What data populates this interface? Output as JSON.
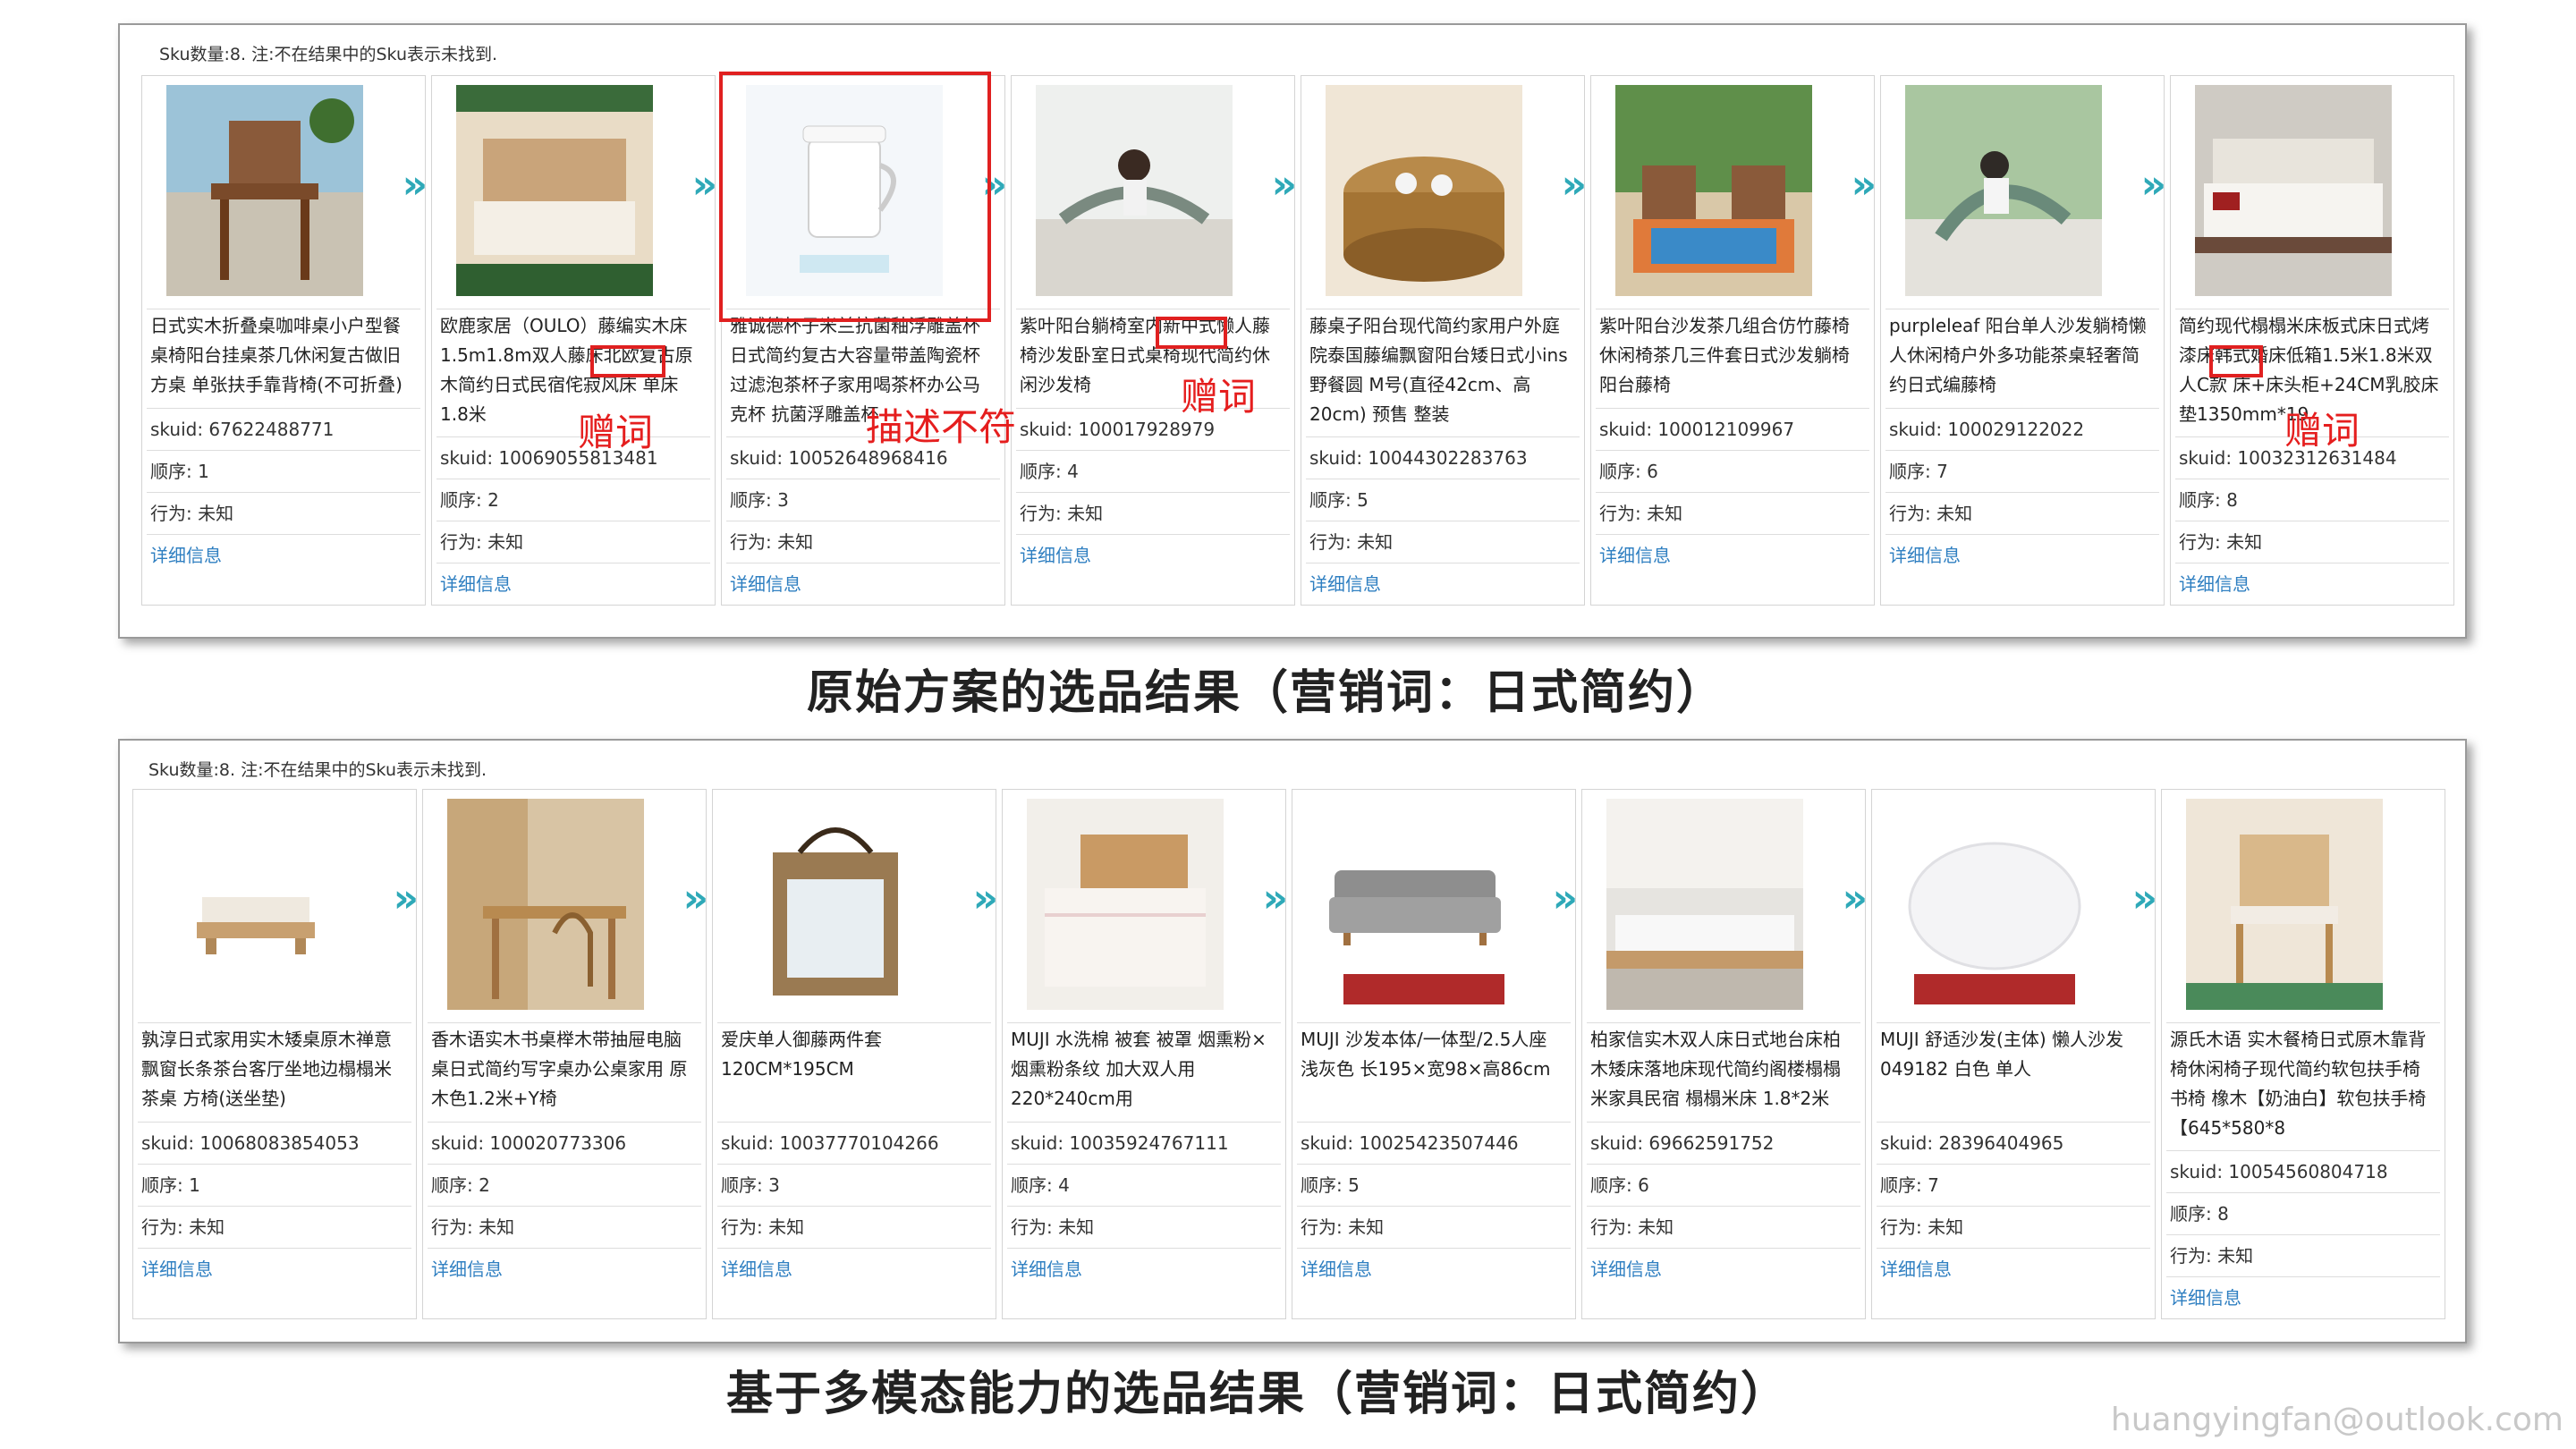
{
  "panel1": {
    "count_text": "Sku数量:8. 注:不在结果中的Sku表示未找到.",
    "caption": "原始方案的选品结果（营销词：日式简约）",
    "cards": [
      {
        "title": "日式实木折叠桌咖啡桌小户型餐桌椅阳台挂桌茶几休闲复古做旧方桌 单张扶手靠背椅(不可折叠)",
        "skuid": "skuid: 67622488771",
        "order": "顺序: 1",
        "behavior": "行为: 未知",
        "detail": "详细信息"
      },
      {
        "title": "欧鹿家居（OULO）藤编实木床1.5m1.8m双人藤床北欧复古原木简约日式民宿侘寂风床 单床 1.8米",
        "skuid": "skuid: 10069055813481",
        "order": "顺序: 2",
        "behavior": "行为: 未知",
        "detail": "详细信息"
      },
      {
        "title": "雅诚德杯子米兰抗菌釉浮雕盖杯日式简约复古大容量带盖陶瓷杯过滤泡茶杯子家用喝茶杯办公马克杯 抗菌浮雕盖杯",
        "skuid": "skuid: 10052648968416",
        "order": "顺序: 3",
        "behavior": "行为: 未知",
        "detail": "详细信息"
      },
      {
        "title": "紫叶阳台躺椅室内新中式懒人藤椅沙发卧室日式桌椅现代简约休闲沙发椅",
        "skuid": "skuid: 100017928979",
        "order": "顺序: 4",
        "behavior": "行为: 未知",
        "detail": "详细信息"
      },
      {
        "title": "藤桌子阳台现代简约家用户外庭院泰国藤编飘窗阳台矮日式小ins野餐圆 M号(直径42cm、高20cm) 预售 整装",
        "skuid": "skuid: 10044302283763",
        "order": "顺序: 5",
        "behavior": "行为: 未知",
        "detail": "详细信息"
      },
      {
        "title": "紫叶阳台沙发茶几组合仿竹藤椅休闲椅茶几三件套日式沙发躺椅阳台藤椅",
        "skuid": "skuid: 100012109967",
        "order": "顺序: 6",
        "behavior": "行为: 未知",
        "detail": "详细信息"
      },
      {
        "title": "purpleleaf 阳台单人沙发躺椅懒人休闲椅户外多功能茶桌轻奢简约日式编藤椅",
        "skuid": "skuid: 100029122022",
        "order": "顺序: 7",
        "behavior": "行为: 未知",
        "detail": "详细信息"
      },
      {
        "title": "简约现代榻榻米床板式床日式烤漆床韩式婚床低箱1.5米1.8米双人C款 床+床头柜+24CM乳胶床垫1350mm*19",
        "skuid": "skuid: 10032312631484",
        "order": "顺序: 8",
        "behavior": "行为: 未知",
        "detail": "详细信息"
      }
    ],
    "annotations": {
      "a1": "赠词",
      "a2": "描述不符",
      "a3": "赠词",
      "a4": "赠词"
    }
  },
  "panel2": {
    "count_text": "Sku数量:8. 注:不在结果中的Sku表示未找到.",
    "caption": "基于多模态能力的选品结果（营销词：日式简约）",
    "cards": [
      {
        "title": "孰淳日式家用实木矮桌原木禅意飘窗长条茶台客厅坐地边榻榻米茶桌 方椅(送坐垫)",
        "skuid": "skuid: 10068083854053",
        "order": "顺序: 1",
        "behavior": "行为: 未知",
        "detail": "详细信息"
      },
      {
        "title": "香木语实木书桌榉木带抽屉电脑桌日式简约写字桌办公桌家用 原木色1.2米+Y椅",
        "skuid": "skuid: 100020773306",
        "order": "顺序: 2",
        "behavior": "行为: 未知",
        "detail": "详细信息"
      },
      {
        "title": "爱庆单人御藤两件套 120CM*195CM",
        "skuid": "skuid: 10037770104266",
        "order": "顺序: 3",
        "behavior": "行为: 未知",
        "detail": "详细信息"
      },
      {
        "title": "MUJI 水洗棉 被套 被罩 烟熏粉×烟熏粉条纹 加大双人用 220*240cm用",
        "skuid": "skuid: 10035924767111",
        "order": "顺序: 4",
        "behavior": "行为: 未知",
        "detail": "详细信息"
      },
      {
        "title": "MUJI 沙发本体/一体型/2.5人座 浅灰色 长195×宽98×高86cm",
        "skuid": "skuid: 10025423507446",
        "order": "顺序: 5",
        "behavior": "行为: 未知",
        "detail": "详细信息"
      },
      {
        "title": "柏家信实木双人床日式地台床柏木矮床落地床现代简约阁楼榻榻米家具民宿 榻榻米床 1.8*2米",
        "skuid": "skuid: 69662591752",
        "order": "顺序: 6",
        "behavior": "行为: 未知",
        "detail": "详细信息"
      },
      {
        "title": "MUJI 舒适沙发(主体) 懒人沙发 049182 白色 单人",
        "skuid": "skuid: 28396404965",
        "order": "顺序: 7",
        "behavior": "行为: 未知",
        "detail": "详细信息"
      },
      {
        "title": "源氏木语 实木餐椅日式原木靠背椅休闲椅子现代简约软包扶手椅书椅 橡木【奶油白】软包扶手椅【645*580*8",
        "skuid": "skuid: 10054560804718",
        "order": "顺序: 8",
        "behavior": "行为: 未知",
        "detail": "详细信息"
      }
    ]
  },
  "arrow_glyph": "»",
  "watermark": "huangyingfan@outlook.com",
  "colors": {
    "accent_link": "#2f7fc1",
    "arrow": "#2fa9b8",
    "annotation": "#e51e1e"
  }
}
